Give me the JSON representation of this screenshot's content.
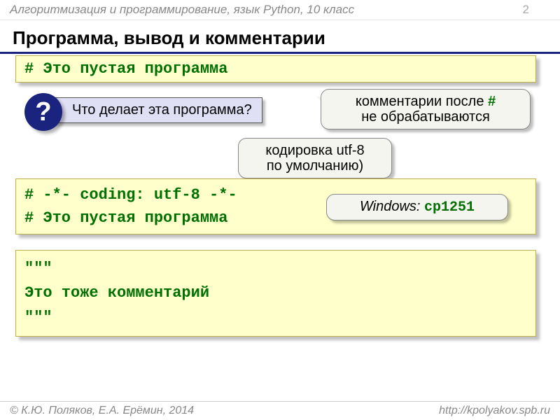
{
  "header": {
    "course": "Алгоритмизация и программирование, язык Python, 10 класс",
    "page": "2"
  },
  "title": "Программа, вывод и комментарии",
  "code1": "# Это пустая программа",
  "question": {
    "mark": "?",
    "text": "Что делает эта программа?"
  },
  "callout_comments_prefix": "комментарии после ",
  "callout_comments_hash": "#",
  "callout_comments_suffix": "не обрабатываются",
  "callout_encoding_l1": "кодировка utf-8",
  "callout_encoding_l2": "по умолчанию)",
  "code2_l1": "# -*- coding: utf-8 -*-",
  "code2_l2": "# Это пустая программа",
  "windows_label": "Windows:",
  "windows_enc": "cp1251",
  "code3_l1": "\"\"\"",
  "code3_l2": "Это тоже комментарий",
  "code3_l3": "\"\"\"",
  "footer": {
    "author": "© К.Ю. Поляков, Е.А. Ерёмин, 2014",
    "url": "http://kpolyakov.spb.ru"
  }
}
